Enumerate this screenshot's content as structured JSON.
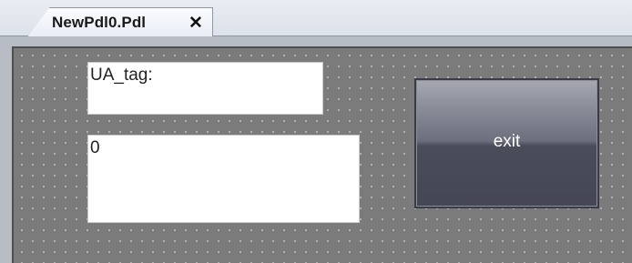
{
  "tab": {
    "title": "NewPdl0.Pdl",
    "close_glyph": "✕"
  },
  "canvas": {
    "tag_label": "UA_tag:",
    "value": "0",
    "exit_label": "exit"
  },
  "colors": {
    "canvas_bg": "#7b7b7b",
    "grid_dot": "#c4c4c4",
    "button_top": "#a6a8b2",
    "button_bottom": "#454654"
  }
}
